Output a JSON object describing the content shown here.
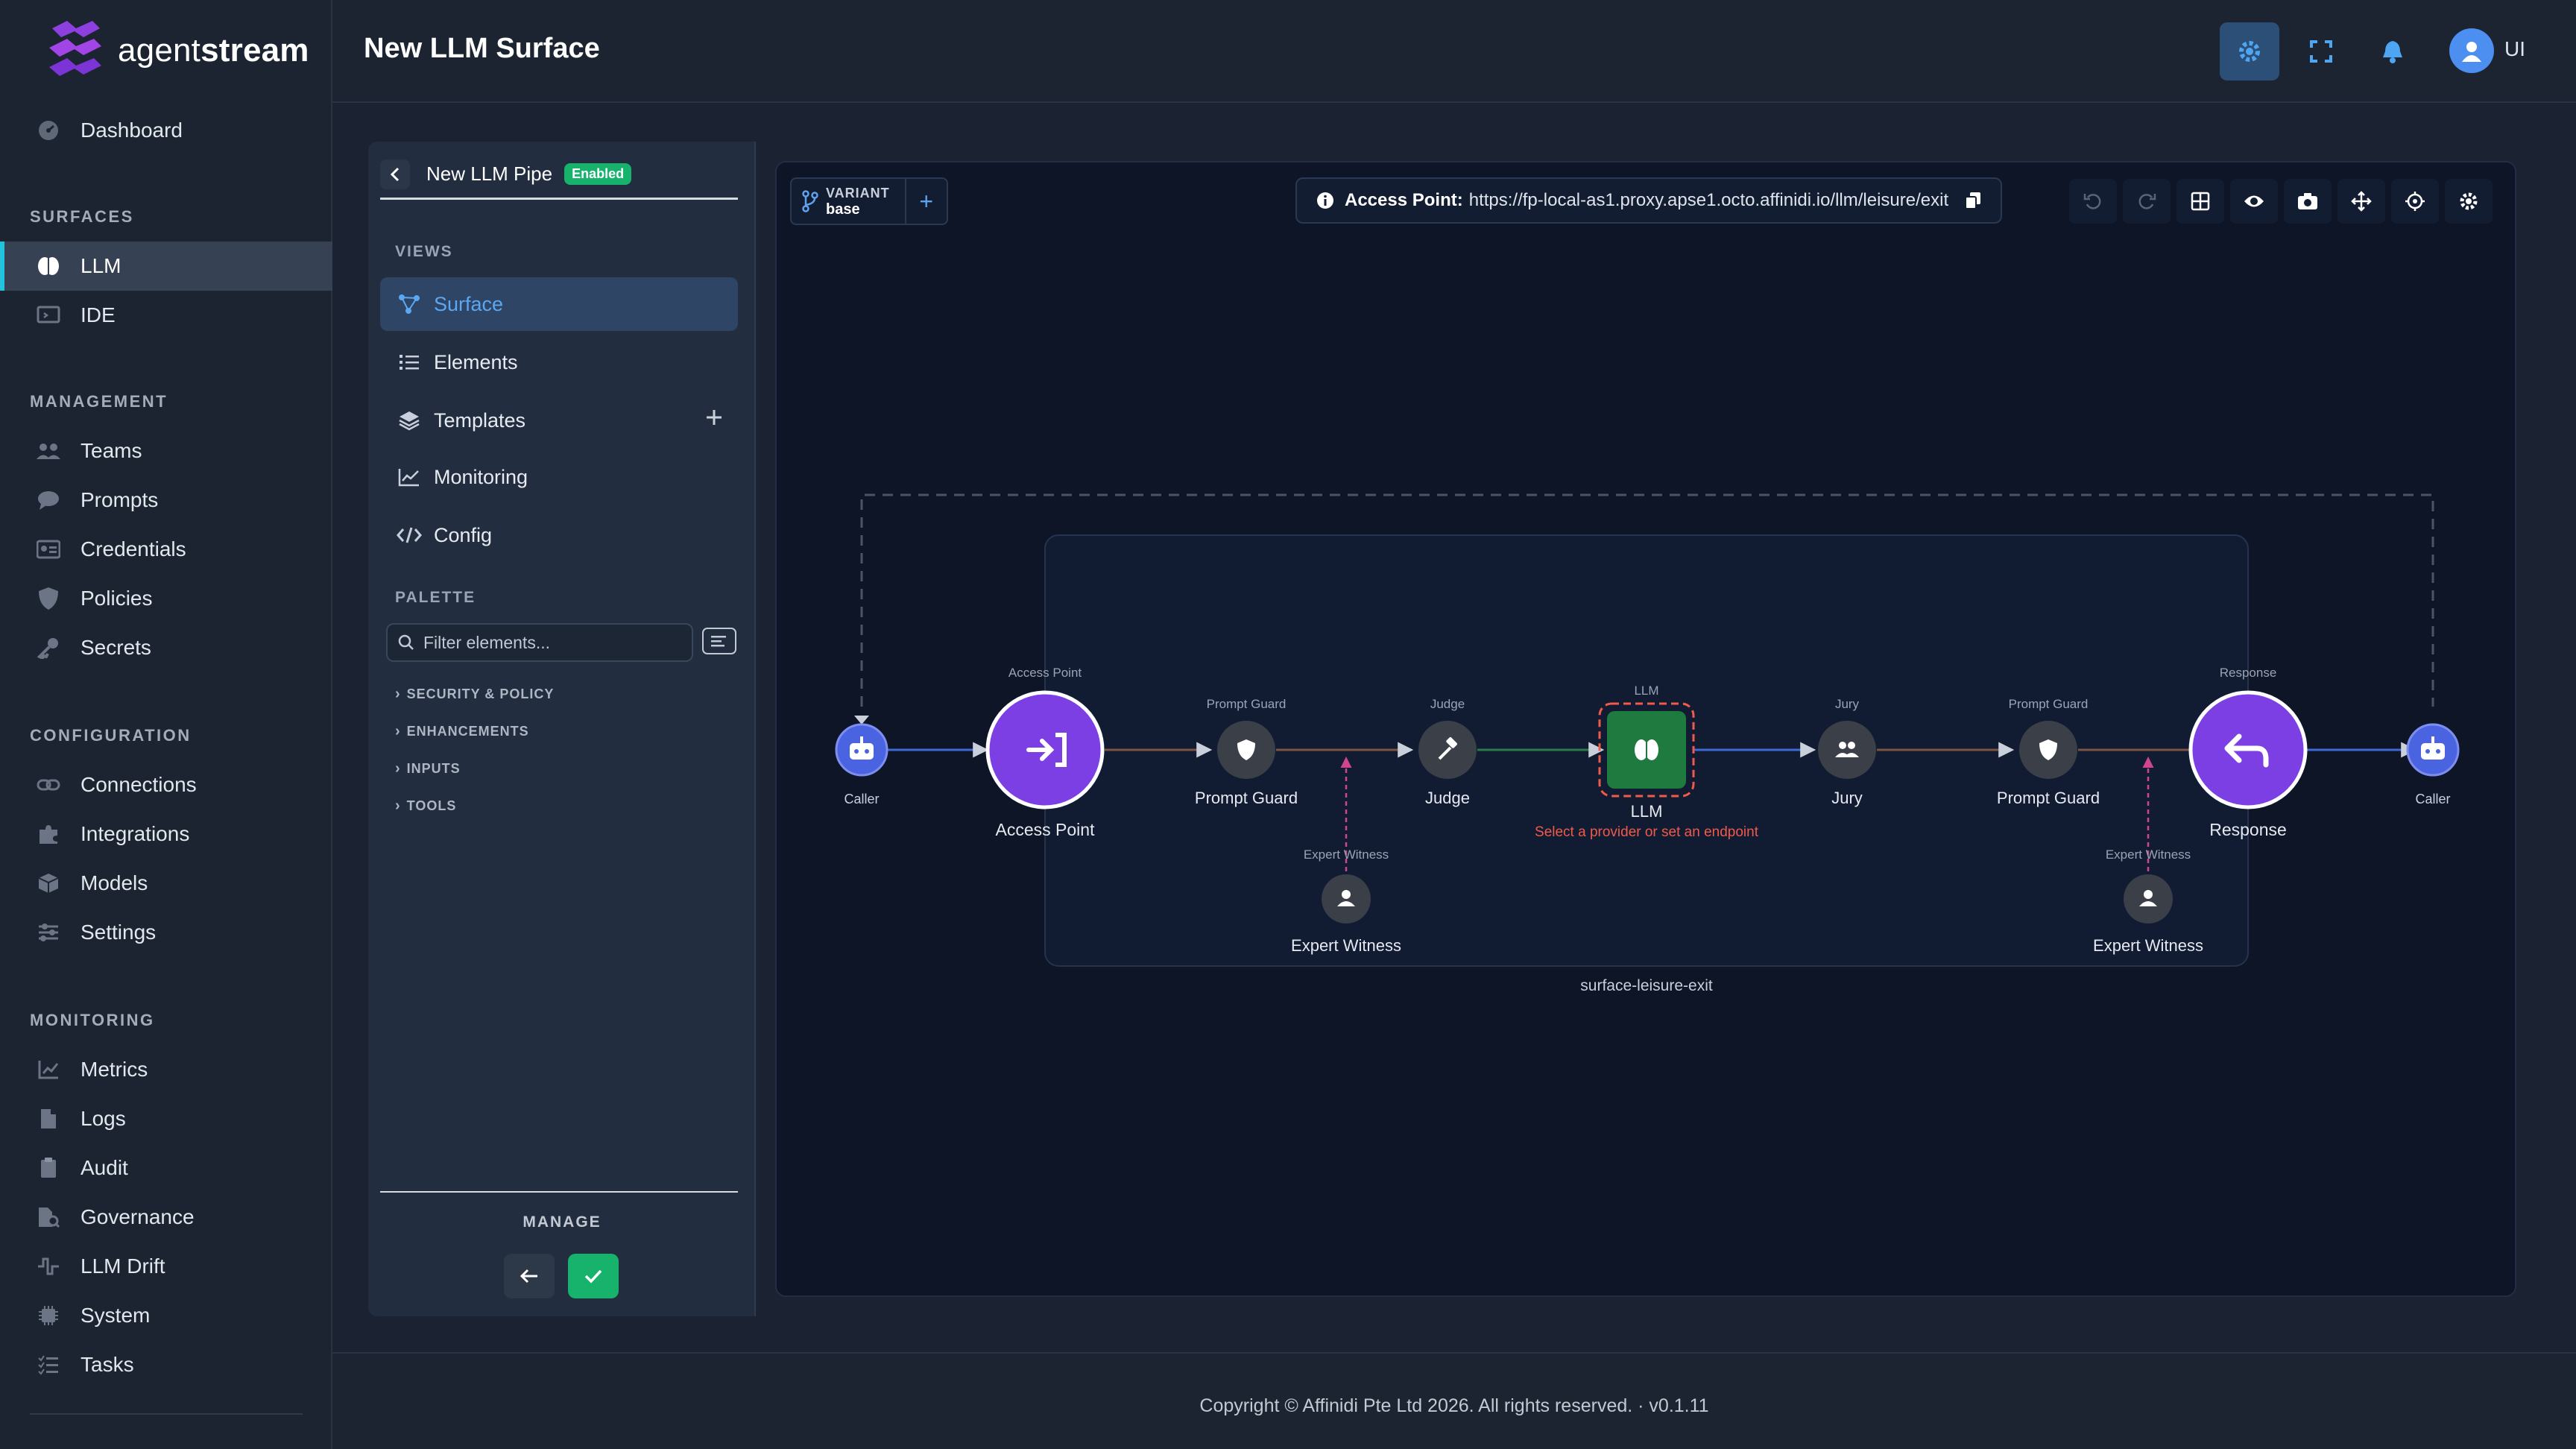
{
  "brand": {
    "name_light": "agent",
    "name_bold": "stream"
  },
  "nav": {
    "dashboard": "Dashboard",
    "sections": {
      "surfaces": "SURFACES",
      "management": "MANAGEMENT",
      "configuration": "CONFIGURATION",
      "monitoring": "MONITORING"
    },
    "items": {
      "llm": "LLM",
      "ide": "IDE",
      "teams": "Teams",
      "prompts": "Prompts",
      "credentials": "Credentials",
      "policies": "Policies",
      "secrets": "Secrets",
      "connections": "Connections",
      "integrations": "Integrations",
      "models": "Models",
      "settings": "Settings",
      "metrics": "Metrics",
      "logs": "Logs",
      "audit": "Audit",
      "governance": "Governance",
      "llm_drift": "LLM Drift",
      "system": "System",
      "tasks": "Tasks"
    },
    "active": "LLM"
  },
  "header": {
    "title": "New LLM Surface",
    "user_initials": "UI"
  },
  "panel": {
    "pipe_name": "New LLM Pipe",
    "status_badge": "Enabled",
    "views_label": "VIEWS",
    "views": {
      "surface": "Surface",
      "elements": "Elements",
      "templates": "Templates",
      "monitoring": "Monitoring",
      "config": "Config"
    },
    "selected_view": "Surface",
    "palette_label": "PALETTE",
    "filter_placeholder": "Filter elements...",
    "categories": {
      "security": "SECURITY & POLICY",
      "enhancements": "ENHANCEMENTS",
      "inputs": "INPUTS",
      "tools": "TOOLS"
    },
    "manage_label": "MANAGE"
  },
  "canvas": {
    "variant_key": "VARIANT",
    "variant_value": "base",
    "access_point_label": "Access Point:",
    "access_point_url": "https://fp-local-as1.proxy.apse1.octo.affinidi.io/llm/leisure/exit",
    "group_label": "surface-leisure-exit",
    "llm_warning": "Select a provider or set an endpoint",
    "nodes": {
      "caller_left": "Caller",
      "access_point_type": "Access Point",
      "access_point": "Access Point",
      "guard1_type": "Prompt Guard",
      "guard1": "Prompt Guard",
      "judge_type": "Judge",
      "judge": "Judge",
      "llm_type": "LLM",
      "llm": "LLM",
      "jury_type": "Jury",
      "jury": "Jury",
      "guard2_type": "Prompt Guard",
      "guard2": "Prompt Guard",
      "response_type": "Response",
      "response": "Response",
      "caller_right": "Caller",
      "witness1_type": "Expert Witness",
      "witness1": "Expert Witness",
      "witness2_type": "Expert Witness",
      "witness2": "Expert Witness"
    }
  },
  "footer": {
    "copyright": "Copyright © Affinidi Pte Ltd 2026. All rights reserved. · v0.1.11"
  },
  "colors": {
    "accent": "#7b3fe4",
    "llm_green": "#1e7a3f",
    "warning": "#f05a4a",
    "enabled": "#17b36c",
    "active_bar": "#22c1dc"
  }
}
